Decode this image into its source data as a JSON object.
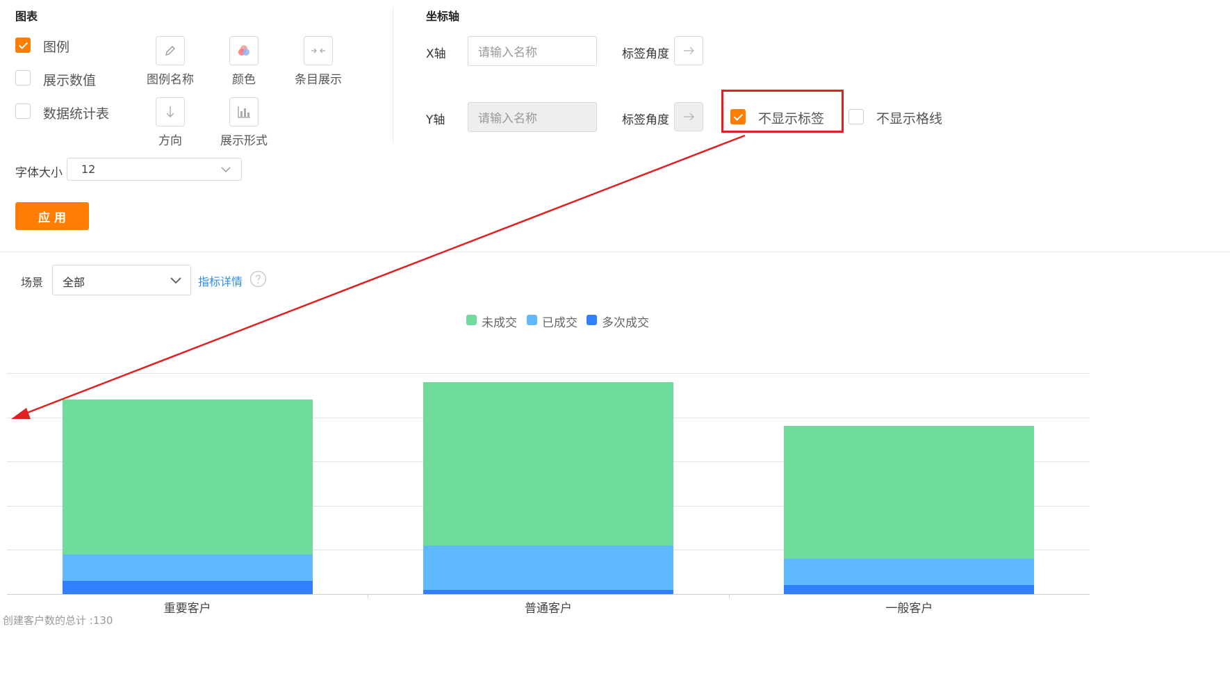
{
  "chart_panel": {
    "title": "图表",
    "legend_label": "图例",
    "show_values_label": "展示数值",
    "data_table_label": "数据统计表",
    "legend_name_label": "图例名称",
    "color_label": "颜色",
    "item_display_label": "条目展示",
    "direction_label": "方向",
    "display_form_label": "展示形式",
    "font_size_label": "字体大小",
    "font_size_value": "12",
    "apply_label": "应 用",
    "legend_checked": true,
    "show_values_checked": false,
    "data_table_checked": false
  },
  "axis_panel": {
    "title": "坐标轴",
    "x_label": "X轴",
    "y_label": "Y轴",
    "x_placeholder": "请输入名称",
    "y_placeholder": "请输入名称",
    "angle_label_x": "标签角度",
    "angle_label_y": "标签角度",
    "hide_labels_label": "不显示标签",
    "hide_gridlines_label": "不显示格线",
    "hide_labels_checked": true,
    "hide_gridlines_checked": false
  },
  "toolbar": {
    "scene_label": "场景",
    "scene_value": "全部",
    "metric_details_label": "指标详情"
  },
  "footer_text": "创建客户数的总计 :130",
  "colors": {
    "accent": "#ff7d00",
    "annotation": "#e02020",
    "link": "#2d8cf0"
  },
  "chart_data": {
    "type": "bar",
    "stacked": true,
    "categories": [
      "重要客户",
      "普通客户",
      "一般客户"
    ],
    "series": [
      {
        "name": "多次成交",
        "color": "#2f80fa",
        "values": [
          3,
          1,
          2
        ]
      },
      {
        "name": "已成交",
        "color": "#60b9fc",
        "values": [
          6,
          10,
          6
        ]
      },
      {
        "name": "未成交",
        "color": "#70dc9c",
        "values": [
          35,
          37,
          30
        ]
      }
    ],
    "ylim": [
      0,
      50
    ],
    "grid": true,
    "legend_position": "top-center",
    "y_tick_labels_hidden": true
  }
}
